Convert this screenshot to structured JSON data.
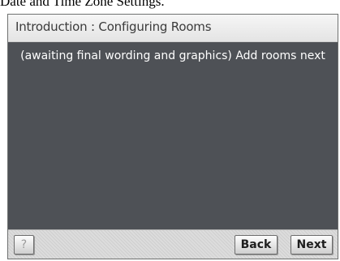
{
  "caption": "Date and Time Zone Settings.",
  "dialog": {
    "title": "Introduction : Configuring Rooms",
    "message": "(awaiting final wording and graphics) Add rooms next"
  },
  "footer": {
    "help_label": "?",
    "back_label": "Back",
    "next_label": "Next"
  },
  "colors": {
    "content_background": "#4e5156",
    "title_bar_background": "#f0f0f0",
    "message_text": "#ffffff"
  }
}
